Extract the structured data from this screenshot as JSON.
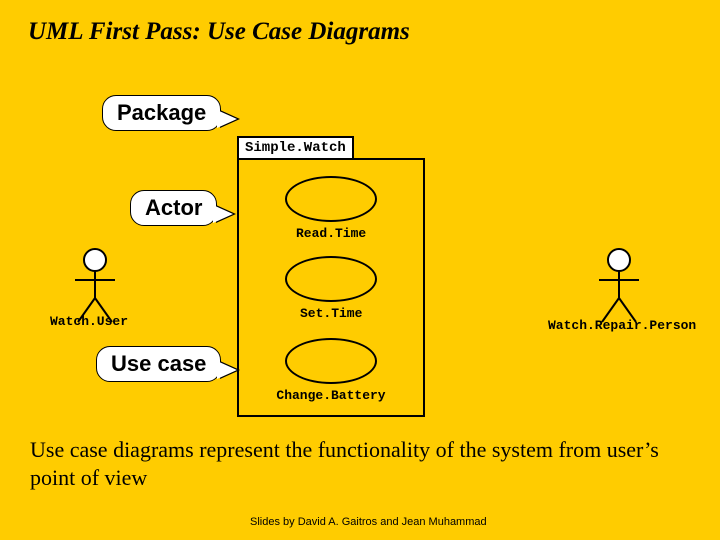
{
  "title": "UML First Pass: Use Case Diagrams",
  "callouts": {
    "package": "Package",
    "actor": "Actor",
    "usecase": "Use case"
  },
  "package": {
    "name": "Simple.Watch"
  },
  "usecases": {
    "read": "Read.Time",
    "set": "Set.Time",
    "change": "Change.Battery"
  },
  "actors": {
    "left": "Watch.User",
    "right": "Watch.Repair.Person"
  },
  "body": "Use case diagrams represent the functionality of the system from user’s point of view",
  "footer": "Slides by David A. Gaitros and Jean Muhammad",
  "chart_data": {
    "type": "diagram",
    "diagram_kind": "uml-use-case",
    "system": "Simple.Watch",
    "actors": [
      "Watch.User",
      "Watch.Repair.Person"
    ],
    "use_cases": [
      "Read.Time",
      "Set.Time",
      "Change.Battery"
    ],
    "annotations": [
      {
        "label": "Package",
        "points_to": "Simple.Watch"
      },
      {
        "label": "Actor",
        "points_to": "Watch.User"
      },
      {
        "label": "Use case",
        "points_to": "Change.Battery"
      }
    ]
  }
}
